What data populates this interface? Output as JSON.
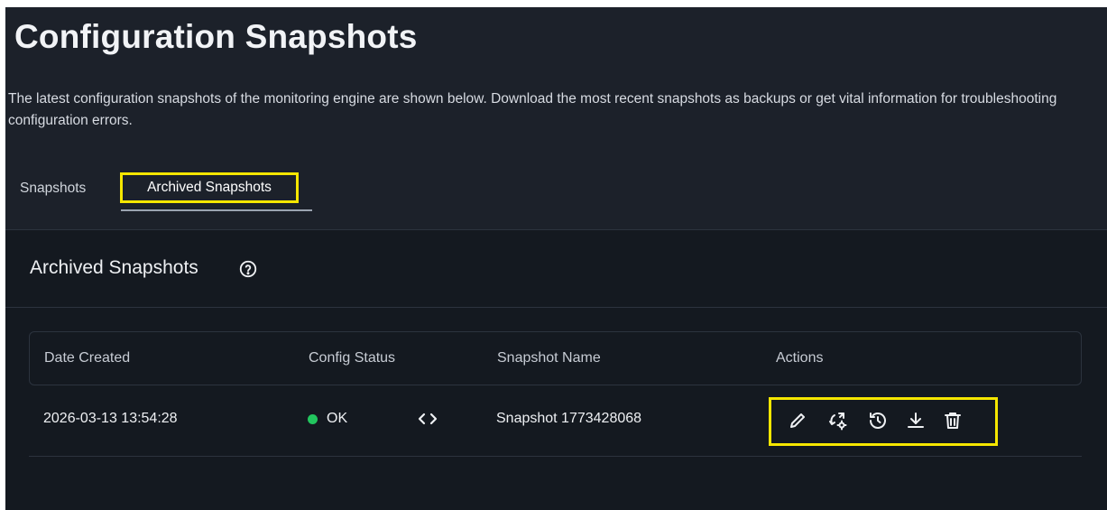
{
  "page": {
    "title": "Configuration Snapshots",
    "description": "The latest configuration snapshots of the monitoring engine are shown below. Download the most recent snapshots as backups or get vital information for troubleshooting configuration errors."
  },
  "tabs": [
    {
      "label": "Snapshots",
      "active": false
    },
    {
      "label": "Archived Snapshots",
      "active": true
    }
  ],
  "panel": {
    "title": "Archived Snapshots",
    "help_icon": "help-circle-icon"
  },
  "table": {
    "columns": [
      "Date Created",
      "Config Status",
      "Snapshot Name",
      "Actions"
    ],
    "rows": [
      {
        "date_created": "2026-03-13 13:54:28",
        "config_status": "OK",
        "status_color": "#22c55e",
        "snapshot_name": "Snapshot 1773428068",
        "actions": [
          "edit-icon",
          "restore-settings-icon",
          "history-restore-icon",
          "download-icon",
          "delete-icon"
        ]
      }
    ]
  },
  "colors": {
    "background": "#1c212a",
    "panel": "#141920",
    "highlight": "#f5e600",
    "status_ok": "#22c55e"
  }
}
